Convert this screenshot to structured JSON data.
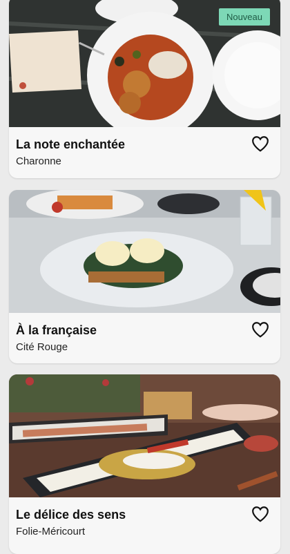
{
  "restaurants": [
    {
      "name": "La note enchantée",
      "location": "Charonne",
      "badge": "Nouveau",
      "image": "dish-meatballs-tomato-sauce",
      "favorite_icon": "heart-outline-icon"
    },
    {
      "name": "À la française",
      "location": "Cité Rouge",
      "image": "dish-eggs-benedict-spinach",
      "favorite_icon": "heart-outline-icon"
    },
    {
      "name": "Le délice des sens",
      "location": "Folie-Méricourt",
      "image": "dish-fish-fillet-platter",
      "favorite_icon": "heart-outline-icon"
    }
  ],
  "colors": {
    "badge_bg": "#7dd8b6",
    "badge_text": "#1f5b45",
    "card_bg": "#f7f7f7",
    "page_bg": "#ebebeb"
  }
}
